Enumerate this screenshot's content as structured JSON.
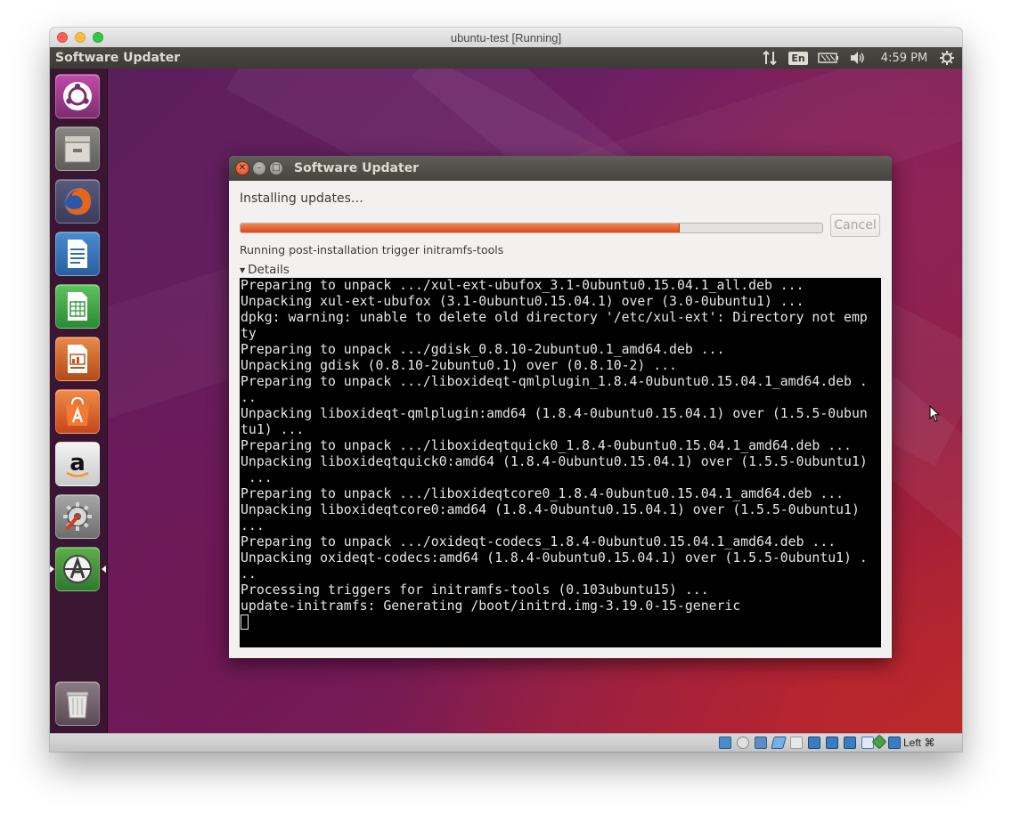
{
  "mac_window": {
    "title": "ubuntu-test [Running]"
  },
  "panel": {
    "app_title": "Software Updater",
    "keyboard_layout": "En",
    "clock": "4:59 PM"
  },
  "launcher": {
    "items": [
      {
        "name": "ubuntu-dash-icon",
        "color": "#7d2d73"
      },
      {
        "name": "files-icon",
        "color": "#6c6a66"
      },
      {
        "name": "firefox-icon",
        "color": "#e06217"
      },
      {
        "name": "libreoffice-writer-icon",
        "color": "#2f6eaf"
      },
      {
        "name": "libreoffice-calc-icon",
        "color": "#2e9a3a"
      },
      {
        "name": "libreoffice-impress-icon",
        "color": "#c7541b"
      },
      {
        "name": "software-center-icon",
        "color": "#e46a2a"
      },
      {
        "name": "amazon-icon",
        "color": "#e8e8e8"
      },
      {
        "name": "system-settings-icon",
        "color": "#8e8e8e"
      },
      {
        "name": "software-updater-icon",
        "color": "#3b8f3b"
      },
      {
        "name": "trash-icon",
        "color": "#6a5a64"
      }
    ]
  },
  "dialog": {
    "title": "Software Updater",
    "status": "Installing updates…",
    "progress": 0.755,
    "cancel_label": "Cancel",
    "sub_status": "Running post-installation trigger initramfs-tools",
    "details_label": "Details",
    "terminal_lines": [
      "Preparing to unpack .../xul-ext-ubufox_3.1-0ubuntu0.15.04.1_all.deb ...",
      "Unpacking xul-ext-ubufox (3.1-0ubuntu0.15.04.1) over (3.0-0ubuntu1) ...",
      "dpkg: warning: unable to delete old directory '/etc/xul-ext': Directory not emp",
      "ty",
      "Preparing to unpack .../gdisk_0.8.10-2ubuntu0.1_amd64.deb ...",
      "Unpacking gdisk (0.8.10-2ubuntu0.1) over (0.8.10-2) ...",
      "Preparing to unpack .../liboxideqt-qmlplugin_1.8.4-0ubuntu0.15.04.1_amd64.deb .",
      "..",
      "Unpacking liboxideqt-qmlplugin:amd64 (1.8.4-0ubuntu0.15.04.1) over (1.5.5-0ubun",
      "tu1) ...",
      "Preparing to unpack .../liboxideqtquick0_1.8.4-0ubuntu0.15.04.1_amd64.deb ...",
      "Unpacking liboxideqtquick0:amd64 (1.8.4-0ubuntu0.15.04.1) over (1.5.5-0ubuntu1)",
      " ...",
      "Preparing to unpack .../liboxideqtcore0_1.8.4-0ubuntu0.15.04.1_amd64.deb ...",
      "Unpacking liboxideqtcore0:amd64 (1.8.4-0ubuntu0.15.04.1) over (1.5.5-0ubuntu1)",
      "...",
      "Preparing to unpack .../oxideqt-codecs_1.8.4-0ubuntu0.15.04.1_amd64.deb ...",
      "Unpacking oxideqt-codecs:amd64 (1.8.4-0ubuntu0.15.04.1) over (1.5.5-0ubuntu1) .",
      "..",
      "Processing triggers for initramfs-tools (0.103ubuntu15) ...",
      "update-initramfs: Generating /boot/initrd.img-3.19.0-15-generic"
    ]
  },
  "vbox_status": {
    "host_key_label": "Left ⌘",
    "icons": [
      "hard-disk-icon",
      "optical-drive-icon",
      "usb-icon",
      "audio-icon",
      "shared-folders-icon",
      "display-icon",
      "network-icon",
      "capture-icon",
      "video-capture-icon",
      "mouse-integration-icon",
      "host-key-icon"
    ]
  }
}
